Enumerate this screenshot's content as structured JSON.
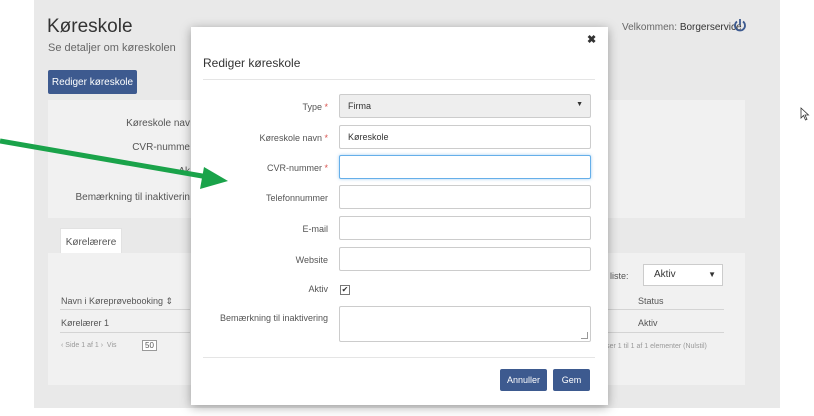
{
  "background": {
    "title": "Køreskole",
    "subtitle": "Se detaljer om køreskolen",
    "welcome_prefix": "Velkommen:",
    "welcome_user": "Borgerservice",
    "edit_button": "Rediger køreskole",
    "labels": [
      "Køreskole nav",
      "CVR-numme",
      "Ak",
      "Bemærkning til inaktiverin"
    ],
    "tab": "Kørelærere",
    "list_filter_label": "af liste:",
    "list_filter_value": "Aktiv",
    "table_header": {
      "name": "Navn i Køreprøvebooking ⇕",
      "status": "Status"
    },
    "table_row": {
      "name": "Kørelærer 1",
      "status": "Aktiv"
    },
    "pager": {
      "page": "Side 1 af 1",
      "per_page_label": "Vis",
      "per_page_value": "50"
    },
    "summary": "Viser 1 til 1 af 1 elementer (Nulstil)"
  },
  "modal": {
    "title": "Rediger køreskole",
    "close": "✖",
    "fields": {
      "type": {
        "label": "Type",
        "value": "Firma"
      },
      "name": {
        "label": "Køreskole navn",
        "value": "Køreskole"
      },
      "cvr": {
        "label": "CVR-nummer",
        "value": ""
      },
      "phone": {
        "label": "Telefonnummer",
        "value": ""
      },
      "email": {
        "label": "E-mail",
        "value": ""
      },
      "website": {
        "label": "Website",
        "value": ""
      },
      "active": {
        "label": "Aktiv",
        "checked": "✔"
      },
      "remark": {
        "label": "Bemærkning til inaktivering"
      }
    },
    "required_mark": "*",
    "cancel_button": "Annuller",
    "save_button": "Gem"
  },
  "colors": {
    "primary": "#3d5a8f",
    "arrow": "#1aa34a",
    "required": "#d9534f"
  }
}
